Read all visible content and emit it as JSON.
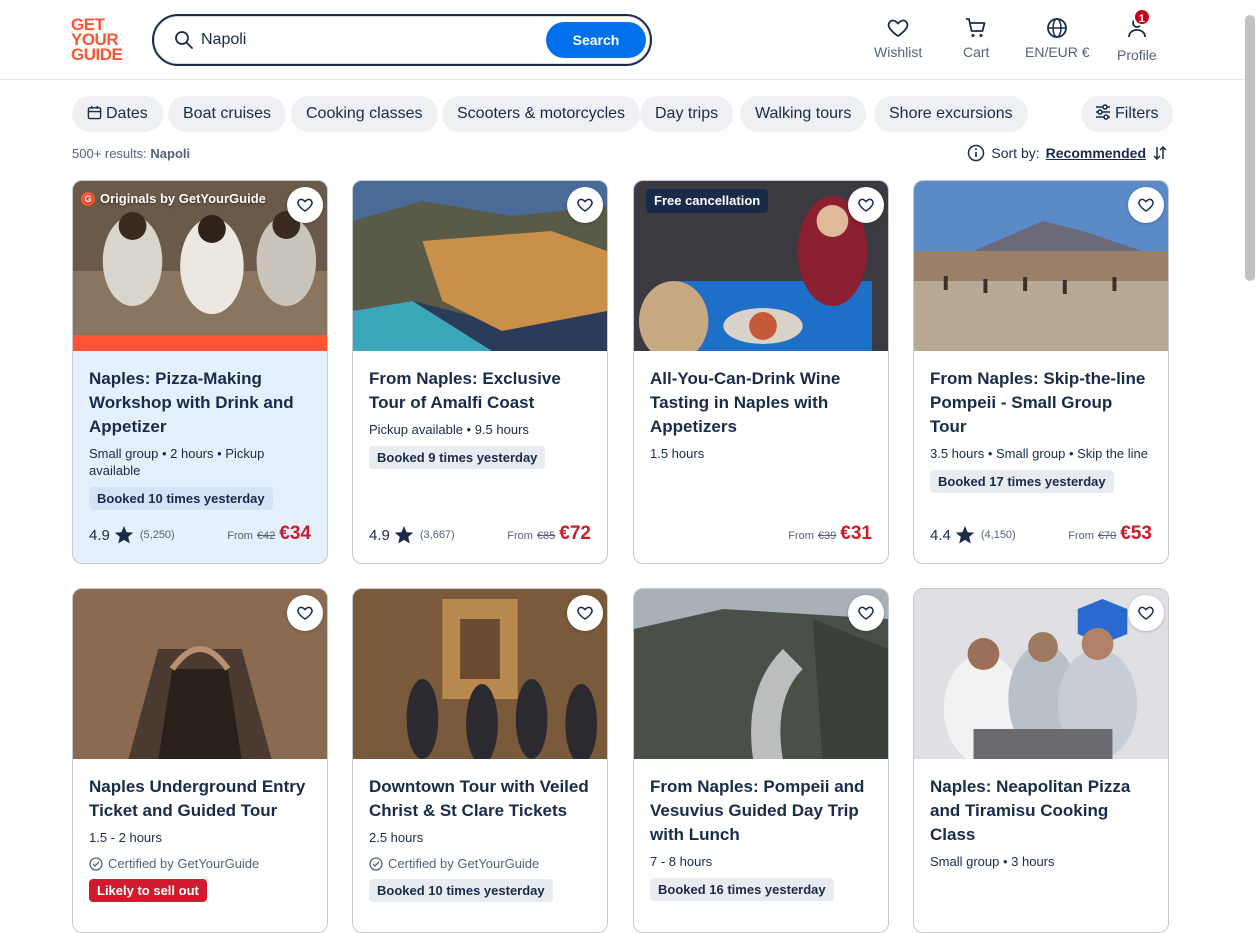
{
  "header": {
    "logo": [
      "GET",
      "YOUR",
      "GUIDE"
    ],
    "search_value": "Napoli",
    "search_button": "Search",
    "nav": [
      {
        "label": "Wishlist",
        "icon": "heart-icon"
      },
      {
        "label": "Cart",
        "icon": "cart-icon"
      },
      {
        "label": "EN/EUR €",
        "icon": "globe-icon"
      },
      {
        "label": "Profile",
        "icon": "profile-icon",
        "badge": "1"
      }
    ]
  },
  "chips": [
    "Dates",
    "Boat cruises",
    "Cooking classes",
    "Scooters & motorcycles",
    "Day trips",
    "Walking tours",
    "Shore excursions"
  ],
  "filters_label": "Filters",
  "results": {
    "count": "500+ results:",
    "query": "Napoli"
  },
  "sort": {
    "label": "Sort by:",
    "value": "Recommended"
  },
  "cards": [
    {
      "title": "Naples: Pizza-Making Workshop with Drink and Appetizer",
      "meta": "Small group • 2 hours • Pickup available",
      "booked": "Booked 10 times yesterday",
      "rating": "4.9",
      "reviews": "(5,250)",
      "from": "From",
      "old_price": "€42",
      "price": "€34",
      "tag": "Originals by GetYourGuide",
      "tag_logo": "G"
    },
    {
      "title": "From Naples: Exclusive Tour of Amalfi Coast",
      "meta": "Pickup available • 9.5 hours",
      "booked": "Booked 9 times yesterday",
      "rating": "4.9",
      "reviews": "(3,667)",
      "from": "From",
      "old_price": "€85",
      "price": "€72"
    },
    {
      "title": "All-You-Can-Drink Wine Tasting in Naples with Appetizers",
      "meta": "1.5 hours",
      "from": "From",
      "old_price": "€39",
      "price": "€31",
      "tag": "Free cancellation"
    },
    {
      "title": "From Naples: Skip-the-line Pompeii - Small Group Tour",
      "meta": "3.5 hours • Small group • Skip the line",
      "booked": "Booked 17 times yesterday",
      "rating": "4.4",
      "reviews": "(4,150)",
      "from": "From",
      "old_price": "€70",
      "price": "€53"
    },
    {
      "title": "Naples Underground Entry Ticket and Guided Tour",
      "meta": "1.5 - 2 hours",
      "certified": "Certified by GetYourGuide",
      "sellout": "Likely to sell out"
    },
    {
      "title": "Downtown Tour with Veiled Christ & St Clare Tickets",
      "meta": "2.5 hours",
      "certified": "Certified by GetYourGuide",
      "booked": "Booked 10 times yesterday"
    },
    {
      "title": "From Naples: Pompeii and Vesuvius Guided Day Trip with Lunch",
      "meta": "7 - 8 hours",
      "booked": "Booked 16 times yesterday"
    },
    {
      "title": "Naples: Neapolitan Pizza and Tiramisu Cooking Class",
      "meta": "Small group • 3 hours"
    }
  ],
  "colors": {
    "brand": "#ff5533",
    "accent": "#0071eb",
    "price": "#d01b2e",
    "text": "#1a2b49"
  }
}
